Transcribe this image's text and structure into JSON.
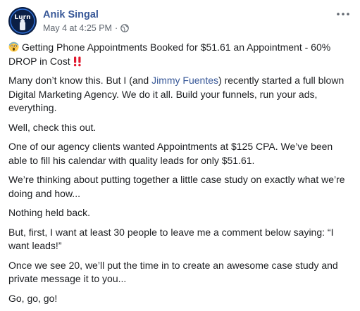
{
  "post": {
    "author": "Anik Singal",
    "date": "May 4 at 4:25 PM",
    "dot": "·",
    "avatar_text": "Lurn",
    "privacy_icon": "globe-icon",
    "more_icon": "more-options-icon",
    "headline": "Getting Phone Appointments Booked for $51.61 an Appointment - 60% DROP in Cost",
    "emoji_lead": "scream-face-icon",
    "emoji_trail": "double-exclamation-icon",
    "p1_before": "Many don’t know this. But I (and ",
    "p1_mention": "Jimmy Fuentes",
    "p1_after": ") recently started a full blown Digital Marketing Agency. We do it all. Build your funnels, run your ads, everything.",
    "p2": "Well, check this out.",
    "p3": "One of our agency clients wanted Appointments at $125 CPA. We’ve been able to fill his calendar with quality leads for only $51.61.",
    "p4": "We’re thinking about putting together a little case study on exactly what we’re doing and how...",
    "p5": "Nothing held back.",
    "p6": "But, first, I want at least 30 people to leave me a comment below saying: “I want leads!”",
    "p7": "Once we see 20, we’ll put the time in to create an awesome case study and private message it to you...",
    "p8": "Go, go, go!"
  },
  "colors": {
    "link": "#385898",
    "meta": "#606770",
    "text": "#1c1e21",
    "avatar_bg": "#0b1f45",
    "emoji_red": "#e0182d"
  }
}
